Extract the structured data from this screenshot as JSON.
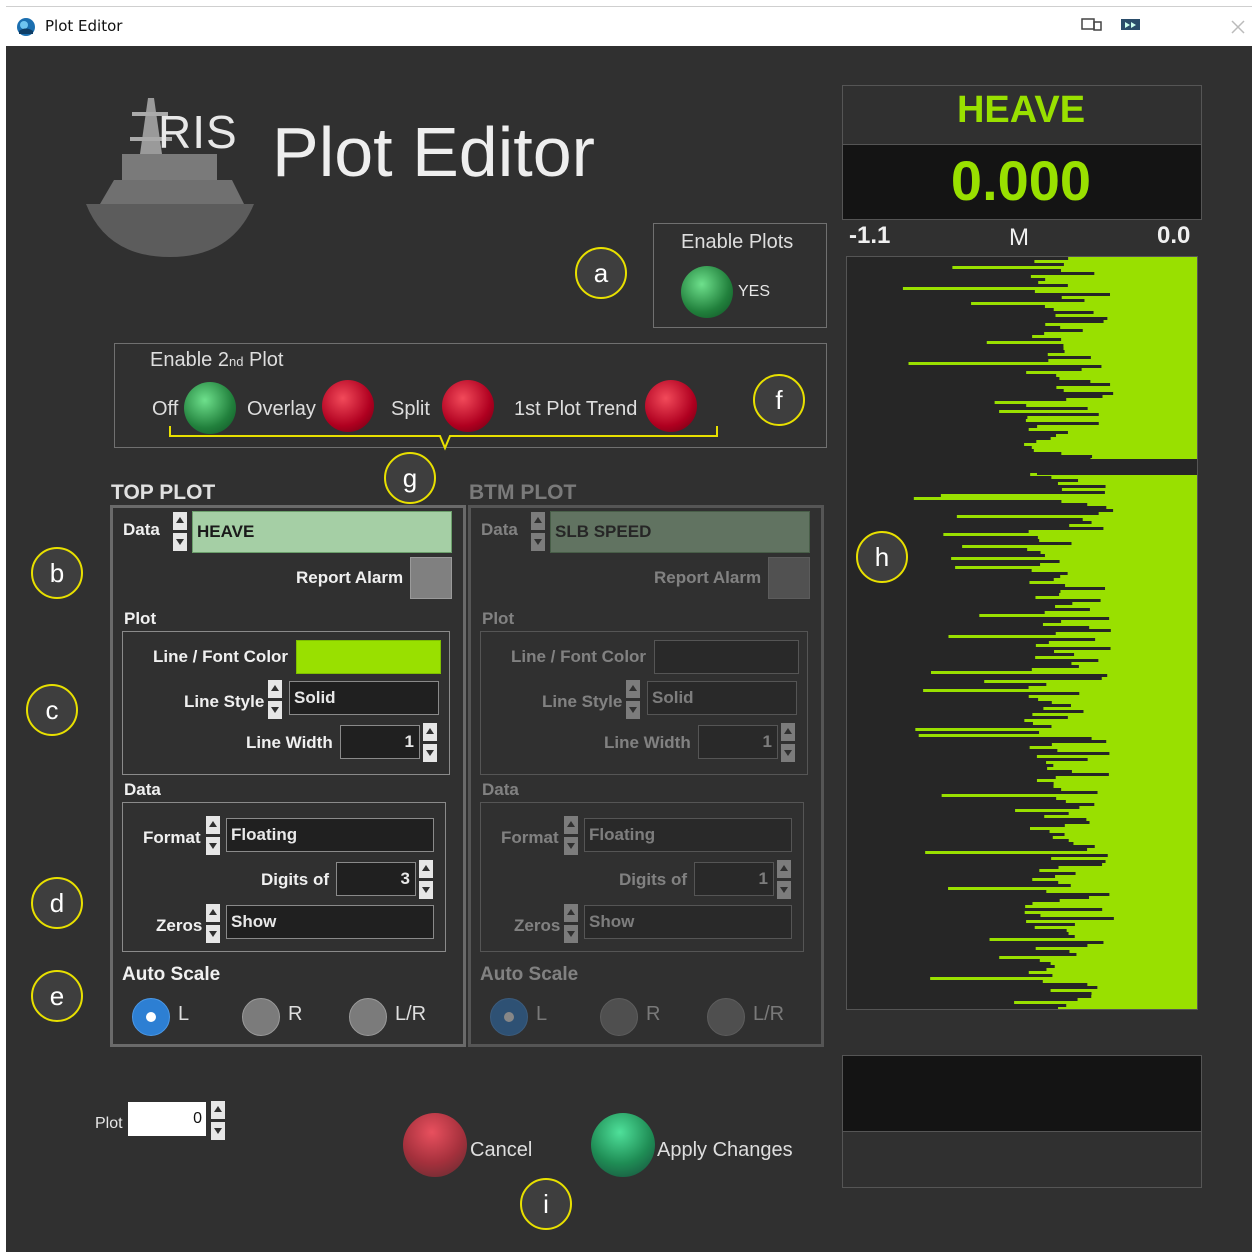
{
  "window": {
    "title": "Plot Editor"
  },
  "header": {
    "logo_text": "RIS",
    "title": "Plot Editor"
  },
  "enable_plots": {
    "label": "Enable Plots",
    "state": "YES"
  },
  "second_plot": {
    "label_main": "Enable 2",
    "label_sub": "nd",
    "label_end": " Plot",
    "options": [
      {
        "label": "Off",
        "active": true
      },
      {
        "label": "Overlay",
        "active": false
      },
      {
        "label": "Split",
        "active": false
      },
      {
        "label": "1st Plot Trend",
        "active": false
      }
    ]
  },
  "top_plot": {
    "title": "TOP PLOT",
    "data_label": "Data",
    "data_value": "HEAVE",
    "report_alarm": "Report Alarm",
    "plot_section": "Plot",
    "line_font_color_label": "Line / Font Color",
    "line_color": "#99e000",
    "line_style_label": "Line Style",
    "line_style": "Solid",
    "line_width_label": "Line Width",
    "line_width": "1",
    "data_section": "Data",
    "format_label": "Format",
    "format": "Floating",
    "digits_label": "Digits of",
    "digits": "3",
    "zeros_label": "Zeros",
    "zeros": "Show",
    "auto_scale_label": "Auto Scale",
    "scale_options": [
      {
        "label": "L",
        "selected": true
      },
      {
        "label": "R",
        "selected": false
      },
      {
        "label": "L/R",
        "selected": false
      }
    ]
  },
  "btm_plot": {
    "title": "BTM PLOT",
    "data_label": "Data",
    "data_value": "SLB SPEED",
    "report_alarm": "Report Alarm",
    "plot_section": "Plot",
    "line_font_color_label": "Line / Font Color",
    "line_style_label": "Line Style",
    "line_style": "Solid",
    "line_width_label": "Line Width",
    "line_width": "1",
    "data_section": "Data",
    "format_label": "Format",
    "format": "Floating",
    "digits_label": "Digits of",
    "digits": "1",
    "zeros_label": "Zeros",
    "zeros": "Show",
    "auto_scale_label": "Auto Scale",
    "scale_options": [
      {
        "label": "L",
        "selected": true
      },
      {
        "label": "R",
        "selected": false
      },
      {
        "label": "L/R",
        "selected": false
      }
    ]
  },
  "plot_selector": {
    "label": "Plot",
    "value": "0"
  },
  "actions": {
    "cancel": "Cancel",
    "apply": "Apply Changes"
  },
  "gauge": {
    "title": "HEAVE",
    "value": "0.000",
    "min": "-1.1",
    "unit": "M",
    "max": "0.0",
    "color": "#99e000"
  },
  "callouts": {
    "a": "a",
    "b": "b",
    "c": "c",
    "d": "d",
    "e": "e",
    "f": "f",
    "g": "g",
    "h": "h",
    "i": "i"
  }
}
